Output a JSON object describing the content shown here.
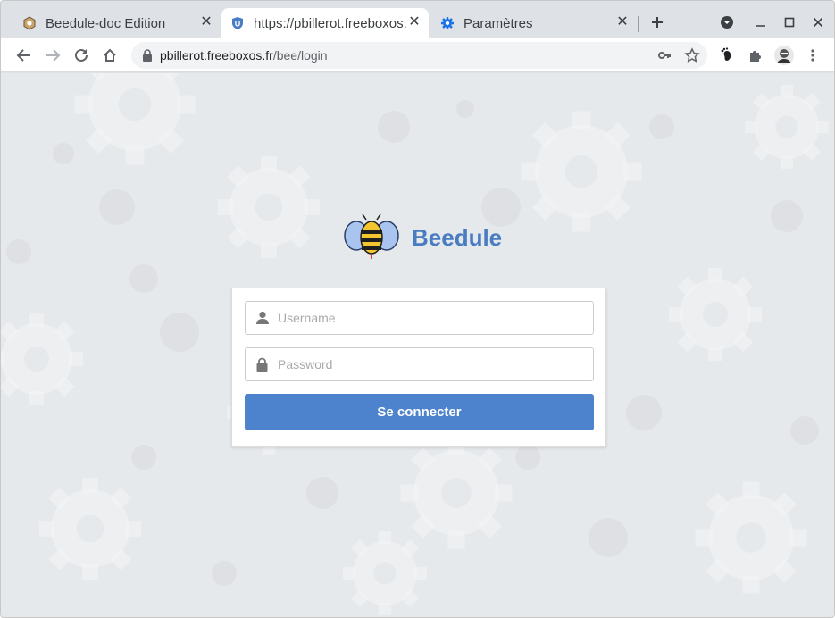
{
  "tabs": [
    {
      "title": "Beedule-doc Edition",
      "active": false
    },
    {
      "title": "https://pbillerot.freeboxos.fr/bee/login",
      "active": true
    },
    {
      "title": "Paramètres",
      "active": false
    }
  ],
  "address_bar": {
    "host": "pbillerot.freeboxos.fr",
    "path": "/bee/login"
  },
  "brand": {
    "name": "Beedule"
  },
  "login": {
    "username_placeholder": "Username",
    "password_placeholder": "Password",
    "submit_label": "Se connecter"
  },
  "icons": {
    "tab1": "hexagon-icon",
    "tab2": "shield-icon",
    "tab3": "gear-icon",
    "user": "user-icon",
    "password": "lock-icon"
  },
  "colors": {
    "accent": "#4d82cc",
    "brand": "#4a7cc2",
    "background": "#e6e9ec"
  }
}
